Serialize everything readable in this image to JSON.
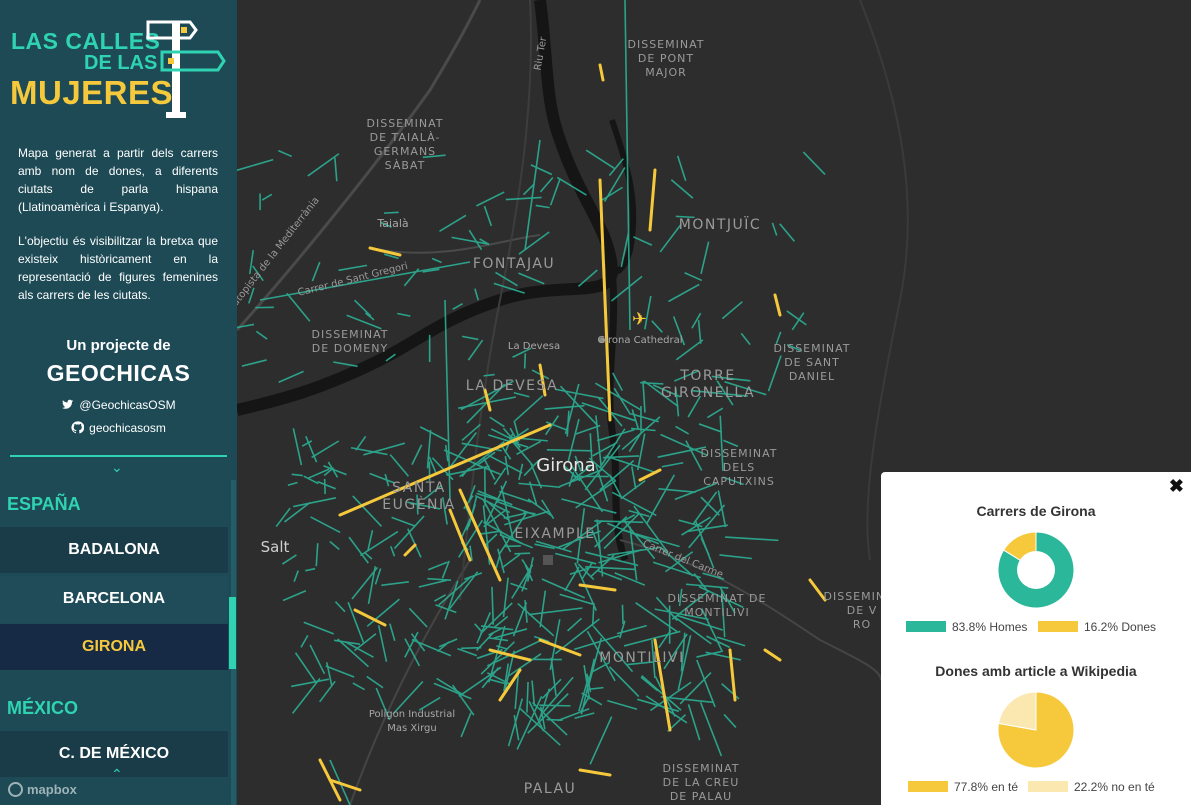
{
  "logo": {
    "line1": "LAS CALLES",
    "line2": "DE LAS",
    "line3": "MUJERES"
  },
  "sidebar": {
    "description_1": "Mapa generat a partir dels carrers amb nom de dones, a diferents ciutats de parla hispana (Llatinoamèrica i Espanya).",
    "description_2": "L'objectiu és visibilitzar la bretxa que existeix històricament en la representació de figures femenines als carrers de les ciutats.",
    "project_label": "Un projecte de",
    "project_name": "GEOCHICAS",
    "twitter": "@GeochicasOSM",
    "github": "geochicasosm",
    "chevron_down": "⌄",
    "chevron_up": "⌃",
    "countries": [
      {
        "name": "ESPAÑA",
        "cities": [
          "BADALONA",
          "BARCELONA",
          "GIRONA"
        ]
      },
      {
        "name": "MÉXICO",
        "cities": [
          "C. DE MÉXICO"
        ]
      }
    ],
    "selected_city": "GIRONA"
  },
  "map": {
    "attribution": "mapbox",
    "labels": {
      "pont_major": "DISSEMINAT\nDE PONT\nMAJOR",
      "taiala_germans": "DISSEMINAT\nDE TAIALÀ-\nGERMANS\nSÀBAT",
      "taiala": "Taialà",
      "fontajau": "FONTAJAU",
      "montjuic": "MONTJUÏC",
      "domeny": "DISSEMINAT\nDE DOMENY",
      "la_devesa_park": "La Devesa",
      "la_devesa": "LA DEVESA",
      "cathedral": "Girona Cathedral",
      "sant_daniel": "DISSEMINAT\nDE SANT\nDANIEL",
      "torre_gironella": "TORRE\nGIRONELLA",
      "girona": "Girona",
      "caputxins": "DISSEMINAT\nDELS\nCAPUTXINS",
      "santa_eugenia": "SANTA\nEUGÈNIA",
      "salt": "Salt",
      "eixample": "EIXAMPLE",
      "montilivi_diss": "DISSEMINAT DE\nMONTILIVI",
      "montilivi": "MONTILIVI",
      "poligon": "Polígon Industrial\nMas Xirgu",
      "palau": "PALAU",
      "creu_palau": "DISSEMINAT\nDE LA CREU\nDE PALAU",
      "partial_right": "DISSEMINAT\nDE V\nRO",
      "carrer_sant_gregori": "Carrer de Sant Gregori",
      "carrer_del_carme": "Carrer del Carme",
      "autopista": "Autopista de la Mediterrània",
      "riu_ter": "Riu Ter"
    }
  },
  "panel": {
    "close_icon": "✖",
    "chart1_title": "Carrers de Girona",
    "chart2_title": "Dones amb article a Wikipedia"
  },
  "colors": {
    "teal": "#2bb79a",
    "yellow": "#f5c93b",
    "light_yellow": "#fbe7b0",
    "sidebar_bg": "#1d4a55",
    "map_bg": "#2d2d2d"
  },
  "chart_data": [
    {
      "type": "pie",
      "title": "Carrers de Girona",
      "donut": true,
      "slices": [
        {
          "label": "83.8% Homes",
          "value": 83.8,
          "color": "#2bb79a"
        },
        {
          "label": "16.2% Dones",
          "value": 16.2,
          "color": "#f5c93b"
        }
      ]
    },
    {
      "type": "pie",
      "title": "Dones amb article a Wikipedia",
      "donut": false,
      "slices": [
        {
          "label": "77.8% en té",
          "value": 77.8,
          "color": "#f5c93b"
        },
        {
          "label": "22.2% no en té",
          "value": 22.2,
          "color": "#fbe7b0"
        }
      ]
    }
  ]
}
